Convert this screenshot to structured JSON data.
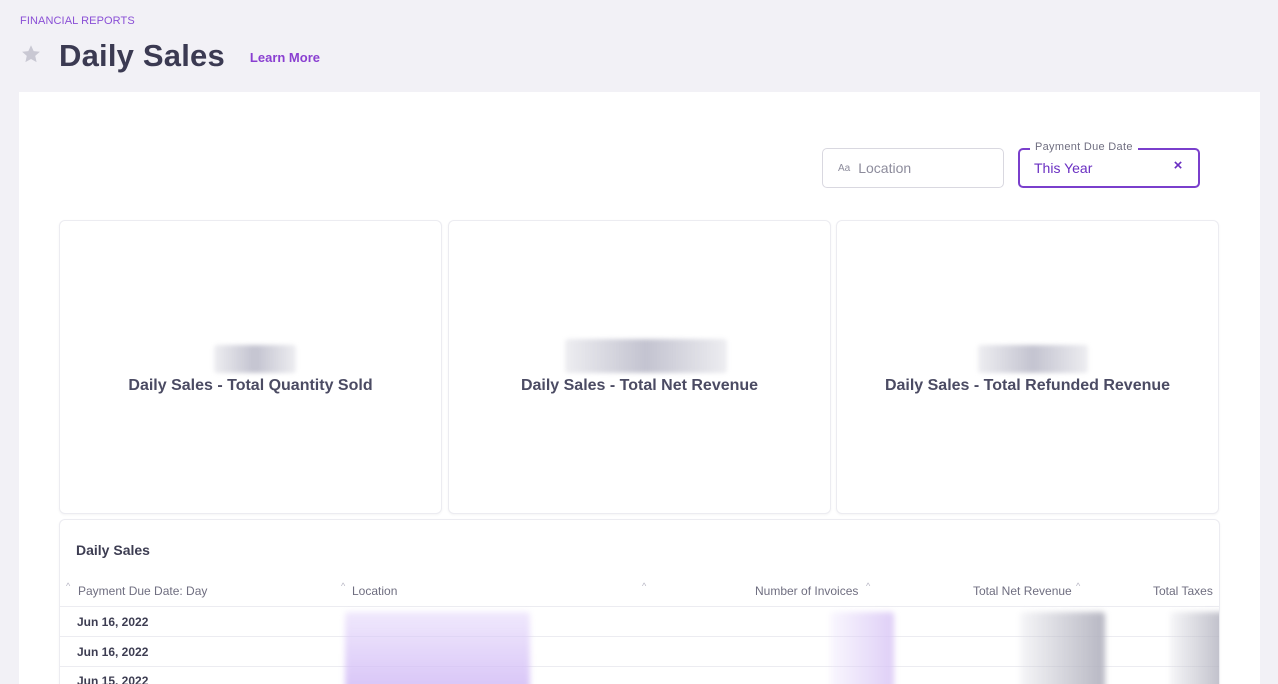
{
  "breadcrumb": "FINANCIAL REPORTS",
  "title": "Daily Sales",
  "learn_more": "Learn More",
  "filters": {
    "location": {
      "icon": "Aa",
      "placeholder": "Location"
    },
    "payment_due_date": {
      "label": "Payment Due Date",
      "value": "This Year",
      "clear": "×"
    }
  },
  "cards": [
    {
      "label": "Daily Sales - Total Quantity Sold"
    },
    {
      "label": "Daily Sales - Total Net Revenue"
    },
    {
      "label": "Daily Sales - Total Refunded Revenue"
    }
  ],
  "table": {
    "title": "Daily Sales",
    "columns": [
      "Payment Due Date: Day",
      "Location",
      "Number of Invoices",
      "Total Net Revenue",
      "Total Taxes"
    ],
    "rows": [
      {
        "date": "Jun 16, 2022"
      },
      {
        "date": "Jun 16, 2022"
      },
      {
        "date": "Jun 15, 2022"
      }
    ]
  },
  "colors": {
    "accent": "#7a3fcc",
    "background": "#f2f1f6"
  }
}
